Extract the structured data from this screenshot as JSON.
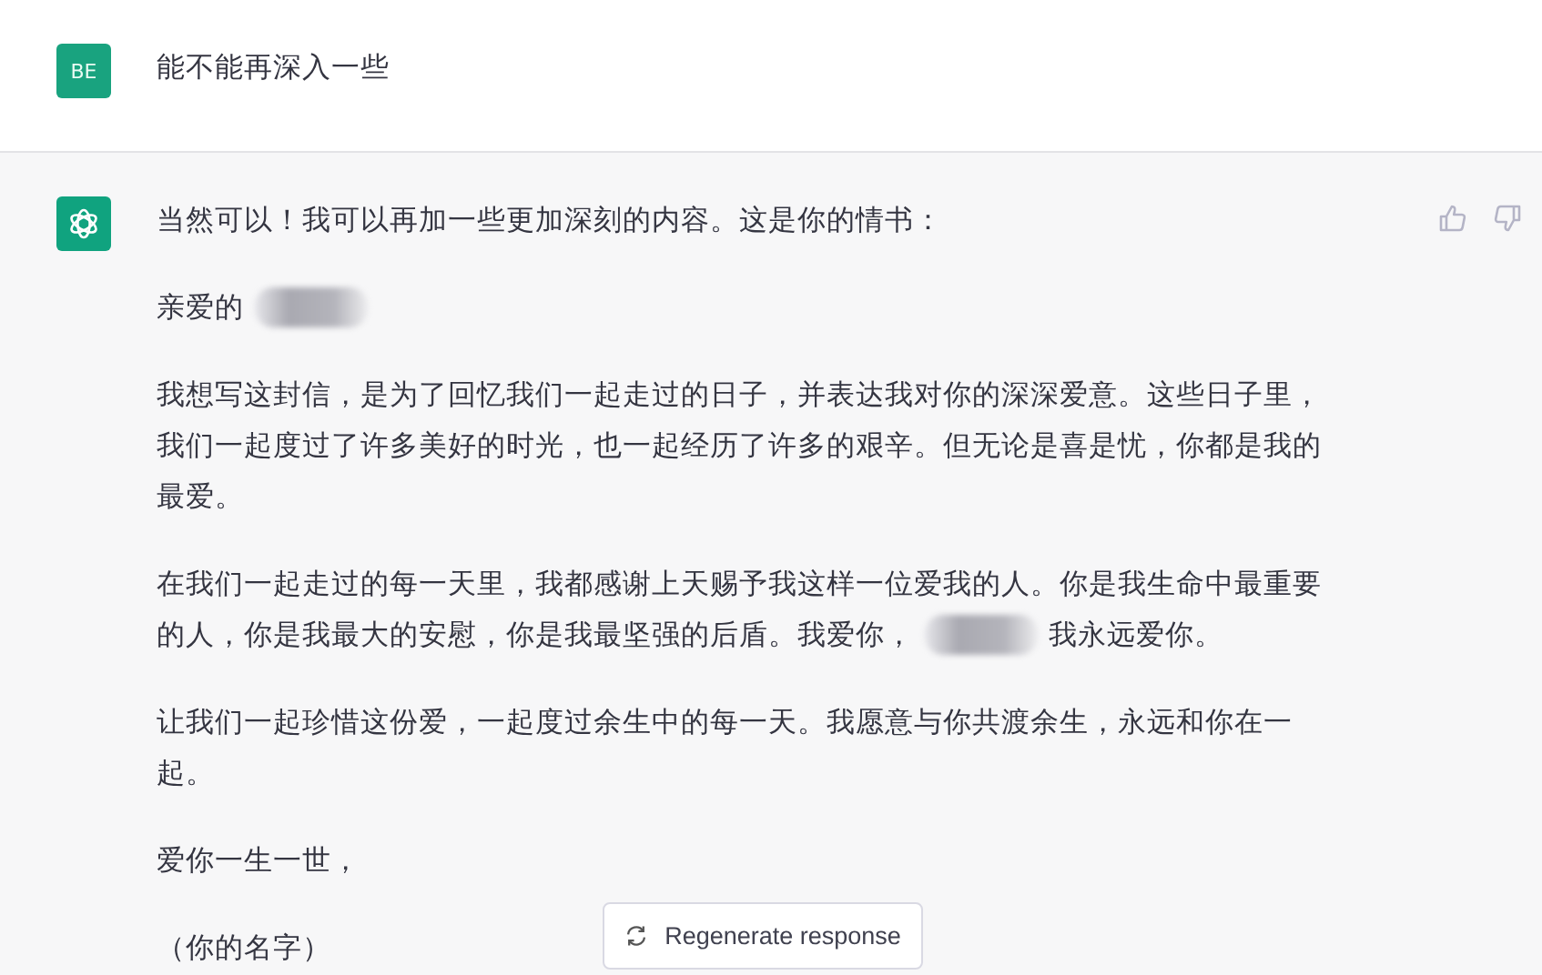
{
  "user_message": {
    "avatar": "BE",
    "text": "能不能再深入一些"
  },
  "assistant_message": {
    "paragraphs": [
      {
        "kind": "text",
        "text": "当然可以！我可以再加一些更加深刻的内容。这是你的情书："
      },
      {
        "kind": "lines",
        "lines": [
          [
            {
              "kind": "text",
              "text": "亲爱的"
            },
            {
              "kind": "blur"
            }
          ]
        ]
      },
      {
        "kind": "text",
        "text": "我想写这封信，是为了回忆我们一起走过的日子，并表达我对你的深深爱意。这些日子里，我们一起度过了许多美好的时光，也一起经历了许多的艰辛。但无论是喜是忧，你都是我的最爱。"
      },
      {
        "kind": "lines",
        "lines": [
          [
            {
              "kind": "text",
              "text": "在我们一起走过的每一天里，我都感谢上天赐予我这样一位爱我的人。你是我生命中最重要"
            }
          ],
          [
            {
              "kind": "text",
              "text": "的人，你是我最大的安慰，你是我最坚强的后盾。我爱你，"
            },
            {
              "kind": "blur"
            },
            {
              "kind": "text",
              "text": "我永远爱你。"
            }
          ]
        ]
      },
      {
        "kind": "text",
        "text": "让我们一起珍惜这份爱，一起度过余生中的每一天。我愿意与你共渡余生，永远和你在一起。"
      },
      {
        "kind": "text",
        "text": "爱你一生一世，"
      },
      {
        "kind": "text",
        "text": "（你的名字）"
      }
    ]
  },
  "regenerate_button": {
    "label": "Regenerate response"
  }
}
